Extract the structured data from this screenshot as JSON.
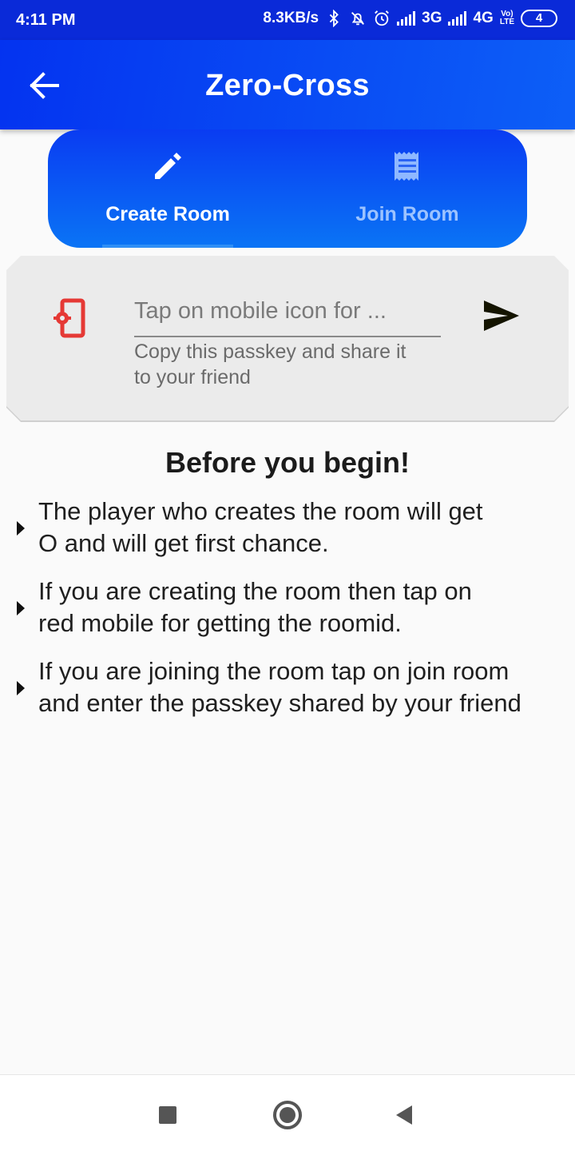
{
  "status_bar": {
    "time": "4:11 PM",
    "net_speed": "8.3KB/s",
    "network_3g": "3G",
    "network_4g": "4G",
    "lte_top": "Vo)",
    "lte_bottom": "LTE",
    "battery": "4",
    "icons": [
      "bluetooth-icon",
      "mute-icon",
      "alarm-icon",
      "signal-icon",
      "battery-icon"
    ]
  },
  "app_bar": {
    "title": "Zero-Cross",
    "back_icon": "arrow-left-icon"
  },
  "tabs": [
    {
      "label": "Create Room",
      "icon": "pencil-icon",
      "selected": true
    },
    {
      "label": "Join Room",
      "icon": "receipt-icon",
      "selected": false
    }
  ],
  "create_card": {
    "mobile_icon": "mobile-settings-icon",
    "input_placeholder": "Tap on mobile icon for ...",
    "input_value": "",
    "helper_text": "Copy this passkey and share it\nto your friend",
    "send_icon": "send-icon"
  },
  "instructions": {
    "heading": "Before you begin!",
    "items": [
      "The player who creates the room will get\n O and will get first chance.",
      "If you are creating the room then tap on\n red mobile for getting the roomid.",
      "If you are joining the room tap on join room\n and enter the passkey shared by your friend"
    ]
  },
  "nav_bar": {
    "buttons": [
      "recents-square-icon",
      "home-circle-icon",
      "back-triangle-icon"
    ]
  },
  "colors": {
    "app_bar": "#0433f0",
    "tab_active_text": "#ffffff",
    "tab_inactive_text": "#9cc3ff",
    "mobile_icon": "#e53935",
    "card_bg": "#ebebeb"
  }
}
